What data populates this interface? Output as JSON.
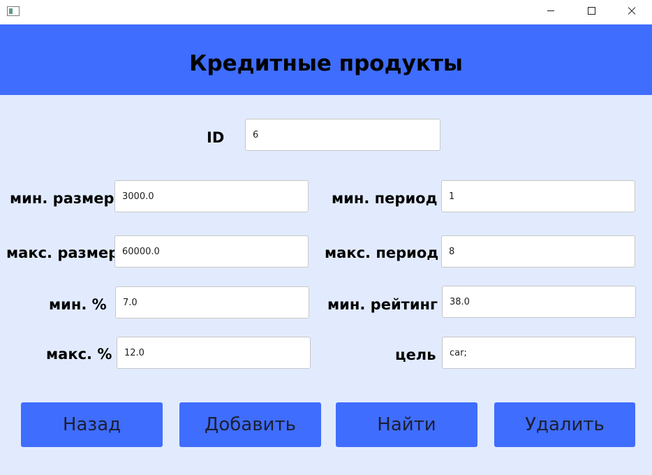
{
  "window": {
    "title": "",
    "controls": [
      "minimize-icon",
      "maximize-icon",
      "close-icon"
    ]
  },
  "header": {
    "title": "Кредитные продукты",
    "bg_color": "#3f6dfd"
  },
  "form": {
    "id": {
      "label": "ID",
      "value": "6"
    },
    "min_size": {
      "label": "мин. размер",
      "value": "3000.0"
    },
    "max_size": {
      "label": "макс. размер",
      "value": "60000.0"
    },
    "min_percent": {
      "label": "мин. %",
      "value": "7.0"
    },
    "max_percent": {
      "label": "макс. %",
      "value": "12.0"
    },
    "min_period": {
      "label": "мин. период",
      "value": "1"
    },
    "max_period": {
      "label": "макс. период",
      "value": "8"
    },
    "min_rating": {
      "label": "мин. рейтинг",
      "value": "38.0"
    },
    "purpose": {
      "label": "цель",
      "value": "car;"
    }
  },
  "buttons": {
    "back": "Назад",
    "add": "Добавить",
    "find": "Найти",
    "delete": "Удалить"
  },
  "colors": {
    "background": "#e2ebfe",
    "accent": "#3f6dfd"
  }
}
